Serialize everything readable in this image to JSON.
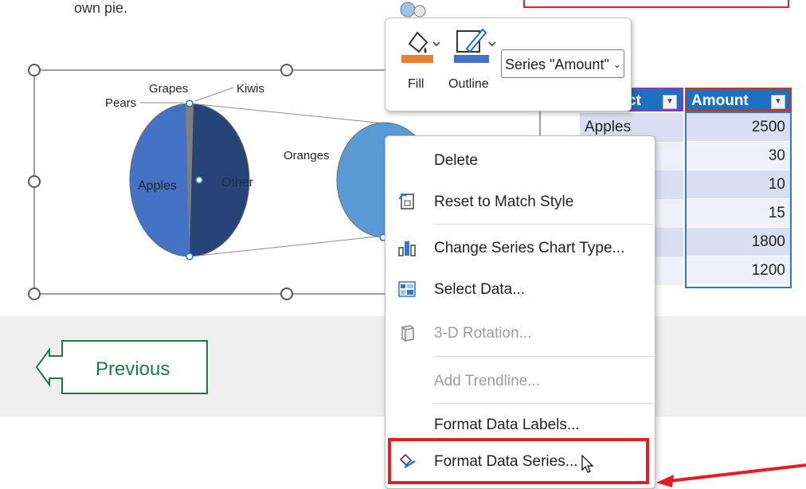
{
  "intro_text": "own pie.",
  "chart": {
    "labels": {
      "pears": "Pears",
      "grapes": "Grapes",
      "kiwis": "Kiwis",
      "apples": "Apples",
      "other": "Other",
      "oranges": "Oranges"
    }
  },
  "chart_data": {
    "type": "pie",
    "subtype": "pie-of-pie",
    "categories": [
      "Apples",
      "Kiwis",
      "Grapes",
      "Pears",
      "Oranges",
      "Other"
    ],
    "values": [
      2500,
      30,
      10,
      15,
      1800,
      1200
    ],
    "series": [
      {
        "name": "Amount",
        "values": [
          2500,
          30,
          10,
          15,
          1800,
          1200
        ]
      }
    ],
    "legend": "none"
  },
  "nav": {
    "previous_label": "Previous"
  },
  "table": {
    "headers": [
      "Product",
      "Amount"
    ],
    "header_visible": [
      "ct",
      "Amount"
    ],
    "first_row_visible": "Apples",
    "amounts": [
      "2500",
      "30",
      "10",
      "15",
      "1800",
      "1200"
    ]
  },
  "format_toolbar": {
    "fill_label": "Fill",
    "outline_label": "Outline",
    "series_select_value": "Series \"Amount\"",
    "fill_color": "#ed7d31",
    "outline_color": "#4472c4"
  },
  "context_menu": {
    "items": [
      {
        "label": "Delete",
        "icon": "none",
        "enabled": true
      },
      {
        "label": "Reset to Match Style",
        "icon": "reset-style-icon",
        "enabled": true
      },
      {
        "label": "Change Series Chart Type...",
        "icon": "chart-type-icon",
        "enabled": true
      },
      {
        "label": "Select Data...",
        "icon": "select-data-icon",
        "enabled": true
      },
      {
        "label": "3-D Rotation...",
        "icon": "cube-icon",
        "enabled": false
      },
      {
        "label": "Add Trendline...",
        "icon": "none",
        "enabled": false
      },
      {
        "label": "Format Data Labels...",
        "icon": "none",
        "enabled": true
      },
      {
        "label": "Format Data Series...",
        "icon": "paint-bucket-icon",
        "enabled": true
      }
    ]
  },
  "colors": {
    "accent_red": "#e61b23",
    "pie_left": "#4472c4",
    "pie_right": "#264478",
    "pie_secondary": "#5b9bd5",
    "table_header": "#1f6fbf",
    "previous_green": "#1e7a44"
  }
}
